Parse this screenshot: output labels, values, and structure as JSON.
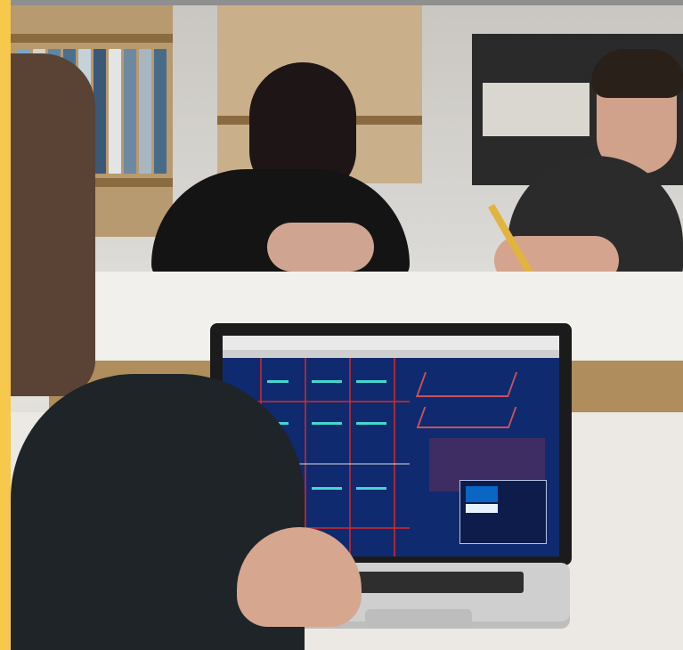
{
  "scene": {
    "accent_color": "#f6c84c"
  }
}
